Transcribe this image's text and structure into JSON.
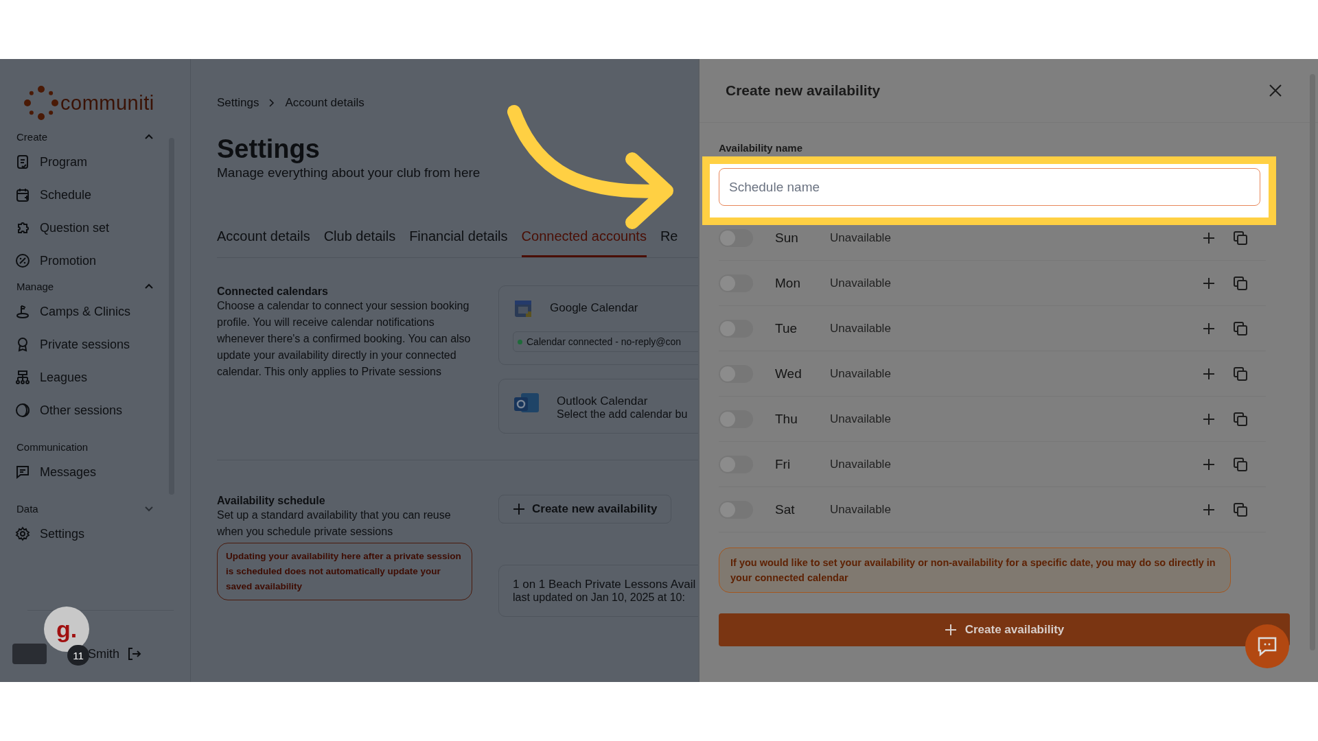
{
  "sidebar": {
    "logo": "communiti",
    "sections": [
      {
        "title": "Create",
        "expanded": true,
        "items": [
          "Program",
          "Schedule",
          "Question set",
          "Promotion"
        ]
      },
      {
        "title": "Manage",
        "expanded": true,
        "items": [
          "Camps & Clinics",
          "Private sessions",
          "Leagues",
          "Other sessions"
        ]
      },
      {
        "title": "Communication",
        "items": [
          "Messages"
        ]
      },
      {
        "title": "Data",
        "expanded": false,
        "items": [
          "Settings"
        ]
      }
    ],
    "user": {
      "name": "Smith",
      "avatar_letter": "g.",
      "notification_count": "11"
    }
  },
  "main": {
    "breadcrumb": [
      "Settings",
      "Account details"
    ],
    "title": "Settings",
    "subtitle": "Manage everything about your club from here",
    "tabs": [
      {
        "label": "Account details",
        "selected": false
      },
      {
        "label": "Club details",
        "selected": false
      },
      {
        "label": "Financial details",
        "selected": false
      },
      {
        "label": "Connected accounts",
        "selected": true
      },
      {
        "label": "Re",
        "selected": false
      }
    ],
    "calendars": {
      "title": "Connected calendars",
      "description": "Choose a calendar to connect your session booking profile. You will receive calendar notifications whenever there's a confirmed booking. You can also update your availability directly in your connected calendar. This only applies to Private sessions",
      "cards": [
        {
          "kind": "google",
          "name": "Google Calendar",
          "status": "Calendar connected - no-reply@con",
          "connected": true
        },
        {
          "kind": "outlook",
          "name": "Outlook Calendar",
          "status": "Select the add calendar bu",
          "connected": false
        }
      ]
    },
    "availability": {
      "title": "Availability schedule",
      "description": "Set up a standard availability that you can reuse when you schedule private sessions",
      "warning": "Updating your availability here after a private session is scheduled does not automatically update your saved availability",
      "create_button": "Create new availability",
      "schedules": [
        {
          "name": "1 on 1 Beach Private Lessons Avail",
          "updated": "last updated on Jan 10, 2025 at 10:"
        }
      ]
    }
  },
  "modal": {
    "title": "Create new availability",
    "name_label": "Availability name",
    "name_field": {
      "placeholder": "Schedule name"
    },
    "days": [
      {
        "day": "Sun",
        "on": false,
        "status": "Unavailable"
      },
      {
        "day": "Mon",
        "on": false,
        "status": "Unavailable"
      },
      {
        "day": "Tue",
        "on": false,
        "status": "Unavailable"
      },
      {
        "day": "Wed",
        "on": false,
        "status": "Unavailable"
      },
      {
        "day": "Thu",
        "on": false,
        "status": "Unavailable"
      },
      {
        "day": "Fri",
        "on": false,
        "status": "Unavailable"
      },
      {
        "day": "Sat",
        "on": false,
        "status": "Unavailable"
      }
    ],
    "note": "If you would like to set your availability or non-availability for a specific date, you may do so directly in your connected calendar",
    "submit_button": "Create availability"
  }
}
